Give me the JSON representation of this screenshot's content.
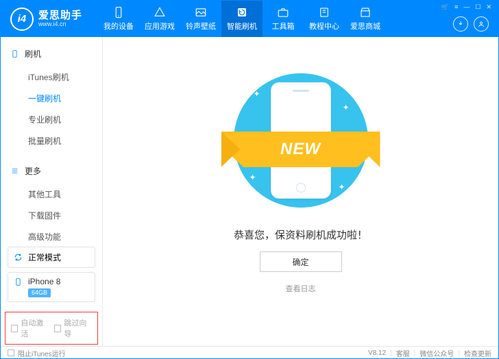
{
  "header": {
    "brand": "爱思助手",
    "url": "www.i4.cn",
    "logoText": "i4",
    "nav": [
      {
        "label": "我的设备",
        "icon": "phone-icon"
      },
      {
        "label": "应用游戏",
        "icon": "apps-icon"
      },
      {
        "label": "铃声壁纸",
        "icon": "image-icon"
      },
      {
        "label": "智能刷机",
        "icon": "refresh-icon",
        "active": true
      },
      {
        "label": "工具箱",
        "icon": "toolbox-icon"
      },
      {
        "label": "教程中心",
        "icon": "book-icon"
      },
      {
        "label": "爱思商城",
        "icon": "store-icon"
      }
    ]
  },
  "sidebar": {
    "groups": [
      {
        "title": "刷机",
        "items": [
          "iTunes刷机",
          "一键刷机",
          "专业刷机",
          "批量刷机"
        ],
        "activeIndex": 1
      },
      {
        "title": "更多",
        "items": [
          "其他工具",
          "下载固件",
          "高级功能"
        ],
        "activeIndex": -1
      }
    ],
    "mode": "正常模式",
    "device": {
      "name": "iPhone 8",
      "storage": "64GB"
    },
    "options": [
      {
        "label": "自动激活",
        "checked": false
      },
      {
        "label": "跳过向导",
        "checked": false
      }
    ]
  },
  "main": {
    "ribbon": "NEW",
    "message": "恭喜您，保资料刷机成功啦！",
    "okButton": "确定",
    "viewLog": "查看日志"
  },
  "status": {
    "blockItunes": "阻止iTunes运行",
    "version": "V8.12",
    "links": [
      "客服",
      "微信公众号",
      "检查更新"
    ]
  }
}
